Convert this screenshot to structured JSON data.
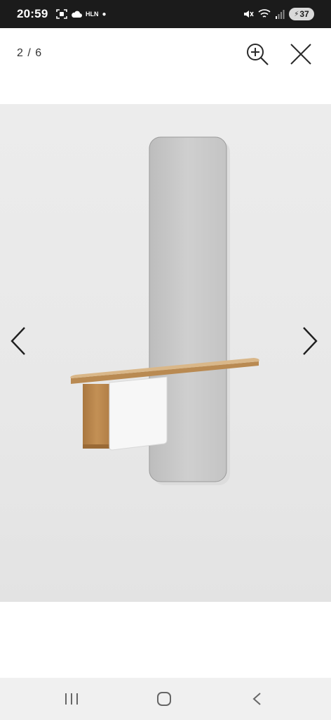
{
  "status_bar": {
    "time": "20:59",
    "network_label": "HLN",
    "battery_level": "37",
    "icons": [
      "screenshot-icon",
      "cloud-icon",
      "dot-icon",
      "mute-icon",
      "wifi-icon",
      "signal-icon",
      "battery-icon"
    ]
  },
  "viewer": {
    "page_counter": "2 / 6",
    "zoom_icon": "zoom-in-icon",
    "close_icon": "close-icon",
    "prev_icon": "chevron-left-icon",
    "next_icon": "chevron-right-icon"
  },
  "nav_bar": {
    "icons": [
      "recent-apps-icon",
      "home-icon",
      "back-icon"
    ]
  },
  "colors": {
    "status_bar_bg": "#1b1b1b",
    "photo_bg": "#e8e8e8",
    "oak": "#c89b61",
    "nav_bar_bg": "#f0f0f0"
  }
}
